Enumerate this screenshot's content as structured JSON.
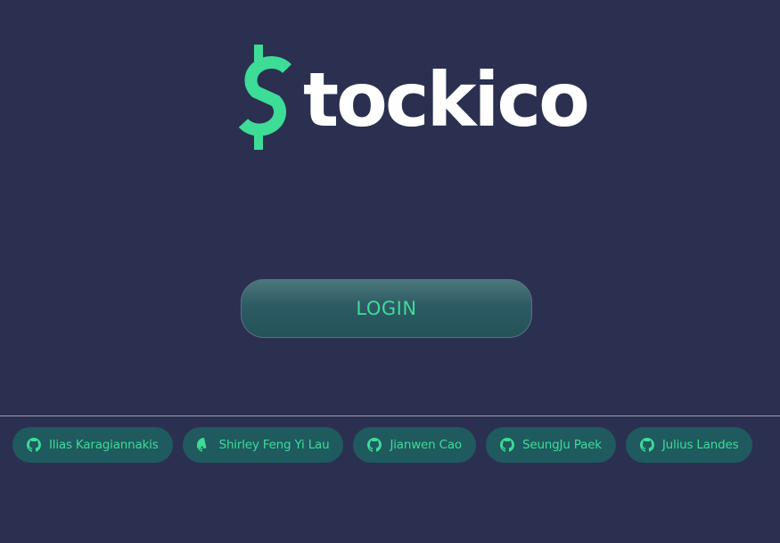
{
  "app": {
    "logo_text": "tockico",
    "logo_symbol": "$",
    "accent_color": "#3ddc97"
  },
  "login": {
    "label": "LOGIN"
  },
  "contributors": [
    {
      "name": "Ilias Karagiannakis",
      "icon": "github-icon"
    },
    {
      "name": "Shirley Feng Yi Lau",
      "icon": "github-icon"
    },
    {
      "name": "Jianwen Cao",
      "icon": "github-icon"
    },
    {
      "name": "SeungJu Paek",
      "icon": "github-icon"
    },
    {
      "name": "Julius Landes",
      "icon": "github-icon"
    }
  ]
}
